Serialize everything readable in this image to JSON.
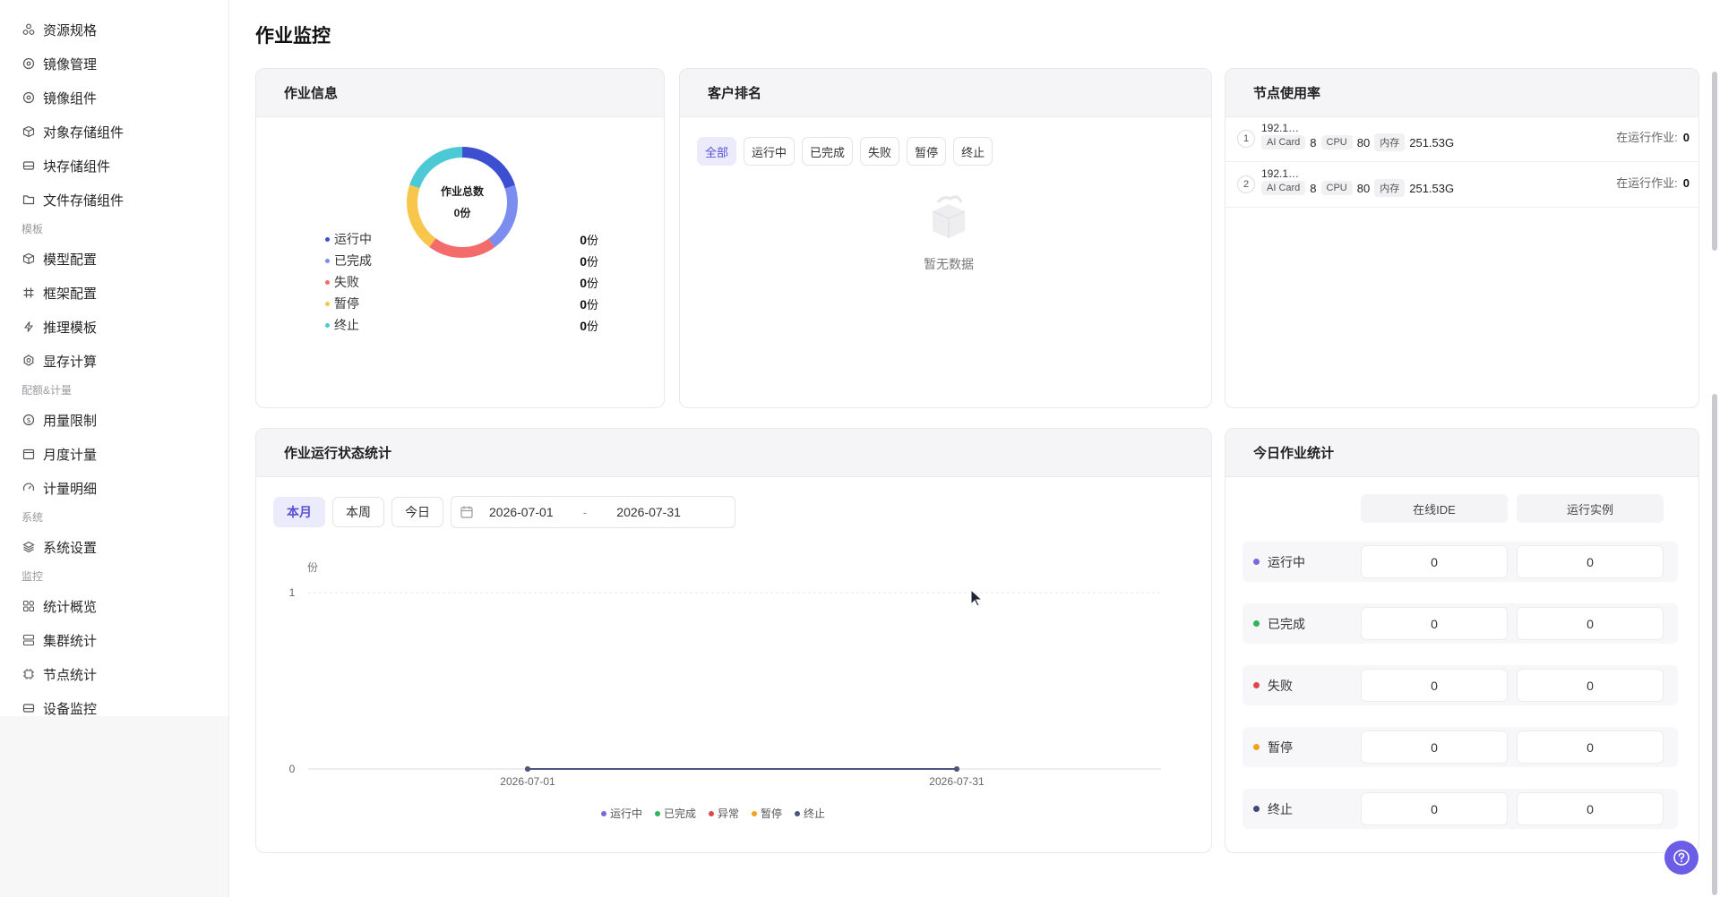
{
  "sidebar": {
    "items": [
      {
        "label": "资源规格",
        "icon": "cluster-icon"
      },
      {
        "label": "镜像管理",
        "icon": "disc-icon"
      },
      {
        "label": "镜像组件",
        "icon": "disc-icon"
      },
      {
        "label": "对象存储组件",
        "icon": "cube-icon"
      },
      {
        "label": "块存储组件",
        "icon": "drive-icon"
      },
      {
        "label": "文件存储组件",
        "icon": "folder-icon"
      }
    ],
    "group_template": "模板",
    "template_items": [
      {
        "label": "模型配置",
        "icon": "cube-icon"
      },
      {
        "label": "框架配置",
        "icon": "hash-icon"
      },
      {
        "label": "推理模板",
        "icon": "bolt-icon"
      },
      {
        "label": "显存计算",
        "icon": "gear-icon"
      }
    ],
    "group_quota": "配额&计量",
    "quota_items": [
      {
        "label": "用量限制",
        "icon": "coin-icon"
      },
      {
        "label": "月度计量",
        "icon": "calendar-icon"
      },
      {
        "label": "计量明细",
        "icon": "gauge-icon"
      }
    ],
    "group_system": "系统",
    "system_items": [
      {
        "label": "系统设置",
        "icon": "layers-icon"
      }
    ],
    "group_monitor": "监控",
    "monitor_items": [
      {
        "label": "统计概览",
        "icon": "grid-icon"
      },
      {
        "label": "集群统计",
        "icon": "server-icon"
      },
      {
        "label": "节点统计",
        "icon": "chip-icon"
      },
      {
        "label": "设备监控",
        "icon": "drive-icon"
      }
    ]
  },
  "page": {
    "title": "作业监控"
  },
  "job_info": {
    "title": "作业信息",
    "center_label": "作业总数",
    "center_value": "0份",
    "legend": [
      {
        "label": "运行中",
        "value": "0",
        "unit": "份",
        "color": "#3d4fd1"
      },
      {
        "label": "已完成",
        "value": "0",
        "unit": "份",
        "color": "#7b8ef0"
      },
      {
        "label": "失败",
        "value": "0",
        "unit": "份",
        "color": "#f46b6b"
      },
      {
        "label": "暂停",
        "value": "0",
        "unit": "份",
        "color": "#f7c64a"
      },
      {
        "label": "终止",
        "value": "0",
        "unit": "份",
        "color": "#4dc9d6"
      }
    ]
  },
  "customer_rank": {
    "title": "客户排名",
    "filters": [
      "全部",
      "运行中",
      "已完成",
      "失败",
      "暂停",
      "终止"
    ],
    "active_filter": "全部",
    "empty_text": "暂无数据"
  },
  "node_usage": {
    "title": "节点使用率",
    "nodes": [
      {
        "index": "1",
        "ip": "192.1…",
        "ai_card_label": "AI Card",
        "ai_card": "8",
        "cpu_label": "CPU",
        "cpu": "80",
        "mem_label": "内存",
        "mem": "251.53G",
        "running_label": "在运行作业:",
        "running": "0"
      },
      {
        "index": "2",
        "ip": "192.1…",
        "ai_card_label": "AI Card",
        "ai_card": "8",
        "cpu_label": "CPU",
        "cpu": "80",
        "mem_label": "内存",
        "mem": "251.53G",
        "running_label": "在运行作业:",
        "running": "0"
      }
    ]
  },
  "run_stats": {
    "title": "作业运行状态统计",
    "ranges": [
      "本月",
      "本周",
      "今日"
    ],
    "active_range": "本月",
    "date_start": "2026-07-01",
    "date_sep": "-",
    "date_end": "2026-07-31"
  },
  "chart_data": {
    "type": "line",
    "ylabel": "份",
    "ylim": [
      0,
      1
    ],
    "y_ticks": [
      "0",
      "1"
    ],
    "x": [
      "2026-07-01",
      "2026-07-31"
    ],
    "x_ticks": [
      "2026-07-01",
      "2026-07-31"
    ],
    "series": [
      {
        "name": "运行中",
        "values": [
          0,
          0
        ],
        "color": "#7a68e0"
      },
      {
        "name": "已完成",
        "values": [
          0,
          0
        ],
        "color": "#2fb55a"
      },
      {
        "name": "异常",
        "values": [
          0,
          0
        ],
        "color": "#e0464a"
      },
      {
        "name": "暂停",
        "values": [
          0,
          0
        ],
        "color": "#f2a21c"
      },
      {
        "name": "终止",
        "values": [
          0,
          0
        ],
        "color": "#4a5680"
      }
    ],
    "grid": true,
    "legend_position": "bottom"
  },
  "today_stats": {
    "title": "今日作业统计",
    "columns": [
      "在线IDE",
      "运行实例"
    ],
    "rows": [
      {
        "label": "运行中",
        "color": "#7a68e0",
        "ide": "0",
        "instance": "0"
      },
      {
        "label": "已完成",
        "color": "#2fb55a",
        "ide": "0",
        "instance": "0"
      },
      {
        "label": "失败",
        "color": "#e0464a",
        "ide": "0",
        "instance": "0"
      },
      {
        "label": "暂停",
        "color": "#f2a21c",
        "ide": "0",
        "instance": "0"
      },
      {
        "label": "终止",
        "color": "#3d4a7a",
        "ide": "0",
        "instance": "0"
      }
    ]
  }
}
